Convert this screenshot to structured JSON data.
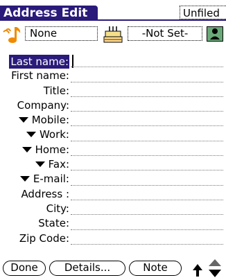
{
  "app": {
    "title": "Address Edit",
    "category": "Unfiled"
  },
  "header": {
    "ringtone_value": "None",
    "birthday_value": "-Not Set-"
  },
  "fields": [
    {
      "label": "Last name:",
      "has_dropdown": false,
      "selected": true
    },
    {
      "label": "First name:",
      "has_dropdown": false
    },
    {
      "label": "Title:",
      "has_dropdown": false
    },
    {
      "label": "Company:",
      "has_dropdown": false
    },
    {
      "label": "Mobile:",
      "has_dropdown": true
    },
    {
      "label": "Work:",
      "has_dropdown": true
    },
    {
      "label": "Home:",
      "has_dropdown": true
    },
    {
      "label": "Fax:",
      "has_dropdown": true
    },
    {
      "label": "E-mail:",
      "has_dropdown": true
    },
    {
      "label": "Address :",
      "has_dropdown": false
    },
    {
      "label": "City:",
      "has_dropdown": false
    },
    {
      "label": "State:",
      "has_dropdown": false
    },
    {
      "label": "Zip Code:",
      "has_dropdown": false
    }
  ],
  "buttons": {
    "done": "Done",
    "details": "Details...",
    "note": "Note"
  },
  "colors": {
    "title_bar": "#2a1a7a",
    "ringtone_icon": "#f08a00",
    "contact_icon_bg": "#6aa878"
  }
}
